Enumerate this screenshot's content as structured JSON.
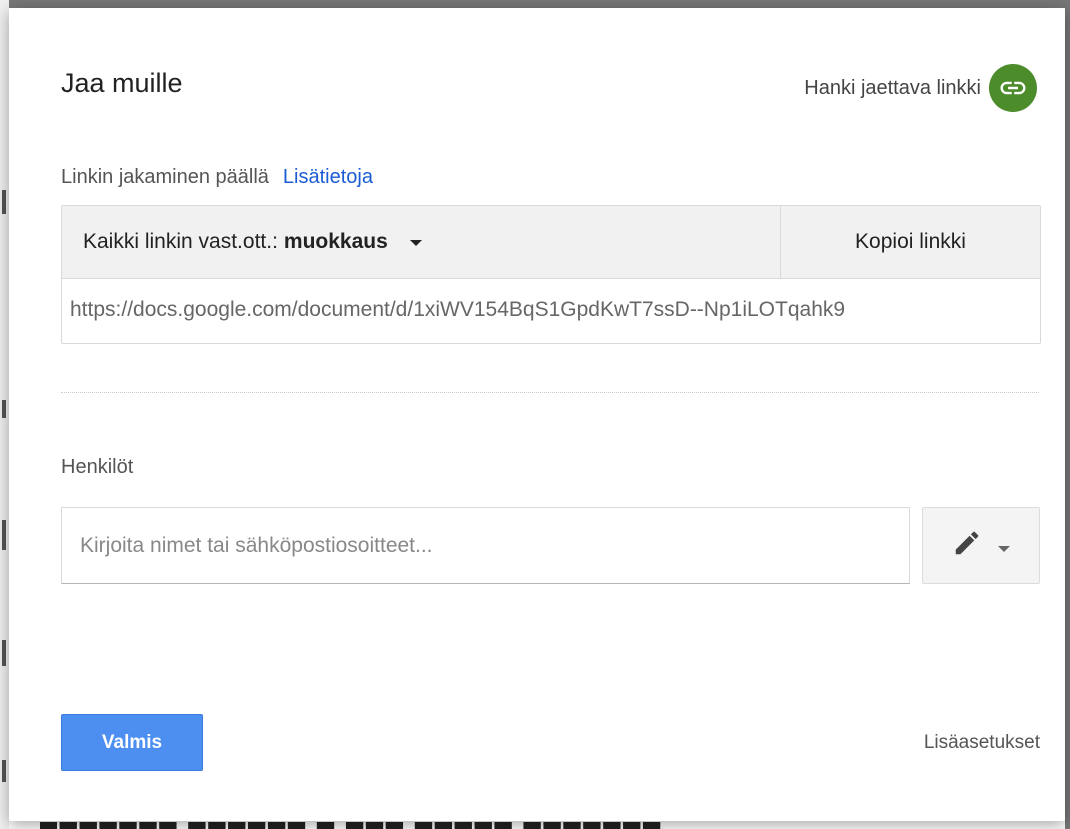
{
  "dialog": {
    "title": "Jaa muille",
    "get_link_label": "Hanki jaettava linkki",
    "get_link_icon": "link-icon",
    "accent_color": "#4c8c2b"
  },
  "link_sharing": {
    "status_text": "Linkin jakaminen päällä",
    "more_info_link": "Lisätietoja",
    "access_prefix": "Kaikki linkin vast.ott.:",
    "access_level": "muokkaus",
    "copy_link_label": "Kopioi linkki",
    "url": "https://docs.google.com/document/d/1xiWV154BqS1GpdKwT7ssD--Np1iLOTqahk9"
  },
  "people": {
    "label": "Henkilöt",
    "placeholder": "Kirjoita nimet tai sähköpostiosoitteet...",
    "permission_icon": "pencil-icon"
  },
  "footer": {
    "done_label": "Valmis",
    "done_color": "#4d8ff0",
    "advanced_label": "Lisäasetukset"
  }
}
